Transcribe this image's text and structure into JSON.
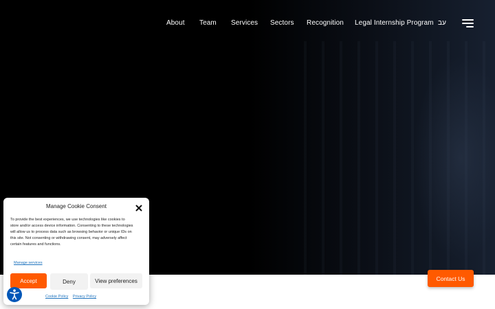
{
  "nav": {
    "items": [
      {
        "label": "About"
      },
      {
        "label": "Team"
      },
      {
        "label": "Services"
      },
      {
        "label": "Sectors"
      },
      {
        "label": "Recognition"
      },
      {
        "label": "Legal Internship Program"
      },
      {
        "label": "עב"
      }
    ],
    "menu_icon": "hamburger-menu-icon"
  },
  "cookie_banner": {
    "title": "Manage Cookie Consent",
    "body": "To provide the best experiences, we use technologies like cookies to store and/or access device information. Consenting to these technologies will allow us to process data such as browsing behavior or unique IDs on this site. Not consenting or withdrawing consent, may adversely affect certain features and functions.",
    "manage_services": "Manage services",
    "accept_label": "Accept",
    "deny_label": "Deny",
    "preferences_label": "View preferences",
    "cookie_policy": "Cookie Policy",
    "privacy_policy": "Privacy Policy",
    "close_icon": "close-icon"
  },
  "accessibility_icon": "accessibility-icon",
  "contact_button": {
    "label": "Contact Us"
  },
  "colors": {
    "accent": "#ff5a00",
    "link": "#1e73be",
    "accessibility": "#0057b8",
    "hero_bg": "#000000"
  }
}
